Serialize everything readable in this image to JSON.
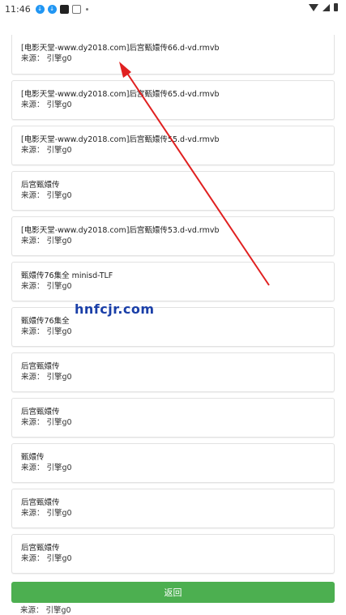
{
  "status_bar": {
    "time": "11:46",
    "icons": [
      "download-icon",
      "download-icon",
      "dark-app-icon",
      "box-icon",
      "dot"
    ]
  },
  "results": [
    {
      "title": "[电影天堂-www.dy2018.com]后宫甄嬛传66.d-vd.rmvb",
      "source": "来源：  引擎g0"
    },
    {
      "title": "[电影天堂-www.dy2018.com]后宫甄嬛传65.d-vd.rmvb",
      "source": "来源：  引擎g0"
    },
    {
      "title": "[电影天堂-www.dy2018.com]后宫甄嬛传55.d-vd.rmvb",
      "source": "来源：  引擎g0"
    },
    {
      "title": "后宫甄嬛传",
      "source": "来源：  引擎g0"
    },
    {
      "title": "[电影天堂-www.dy2018.com]后宫甄嬛传53.d-vd.rmvb",
      "source": "来源：  引擎g0"
    },
    {
      "title": "甄嬛传76集全 minisd-TLF",
      "source": "来源：  引擎g0"
    },
    {
      "title": "甄嬛传76集全",
      "source": "来源：  引擎g0"
    },
    {
      "title": "后宫甄嬛传",
      "source": "来源：  引擎g0"
    },
    {
      "title": "后宫甄嬛传",
      "source": "来源：  引擎g0"
    },
    {
      "title": "甄嬛传",
      "source": "来源：  引擎g0"
    },
    {
      "title": "后宫甄嬛传",
      "source": "来源：  引擎g0"
    },
    {
      "title": "后宫甄嬛传",
      "source": "来源：  引擎g0"
    }
  ],
  "peek_source": "来源：  引擎g0",
  "watermark": "hnfcjr.com",
  "back_button": "返回",
  "colors": {
    "button": "#4CAF50",
    "arrow": "#e02020",
    "watermark": "#1a3fa8"
  }
}
